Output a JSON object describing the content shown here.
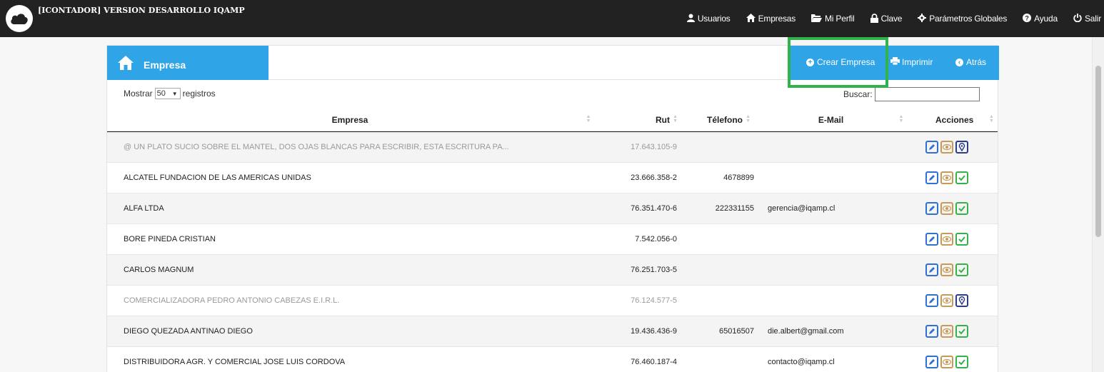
{
  "brand": "[ICONTADOR] VERSION DESARROLLO IQAMP",
  "nav": [
    {
      "label": "Usuarios",
      "icon": "user-icon"
    },
    {
      "label": "Empresas",
      "icon": "home-icon"
    },
    {
      "label": "Mi Perfil",
      "icon": "folder-icon"
    },
    {
      "label": "Clave",
      "icon": "lock-icon"
    },
    {
      "label": "Parámetros Globales",
      "icon": "gear-icon"
    },
    {
      "label": "Ayuda",
      "icon": "question-icon"
    },
    {
      "label": "Salir",
      "icon": "power-icon"
    }
  ],
  "panel": {
    "title": "Empresa",
    "actions": {
      "create": "Crear Empresa",
      "print": "Imprimir",
      "back": "Atrás"
    }
  },
  "controls": {
    "show_prefix": "Mostrar",
    "page_size": "50",
    "show_suffix": "registros",
    "search_label": "Buscar:",
    "search_value": ""
  },
  "table": {
    "columns": [
      "Empresa",
      "Rut",
      "Télefono",
      "E-Mail",
      "Acciones"
    ],
    "rows": [
      {
        "empresa": "@ UN PLATO SUCIO SOBRE EL MANTEL, DOS OJAS BLANCAS PARA ESCRIBIR, ESTA ESCRITURA PA...",
        "rut": "17.643.105-9",
        "telefono": "",
        "email": "",
        "muted": true,
        "third": "map-pin"
      },
      {
        "empresa": "ALCATEL FUNDACION DE LAS AMERICAS UNIDAS",
        "rut": "23.666.358-2",
        "telefono": "4678899",
        "email": "",
        "muted": false,
        "third": "check"
      },
      {
        "empresa": "ALFA LTDA",
        "rut": "76.351.470-6",
        "telefono": "222331155",
        "email": "gerencia@iqamp.cl",
        "muted": false,
        "third": "check"
      },
      {
        "empresa": "BORE PINEDA CRISTIAN",
        "rut": "7.542.056-0",
        "telefono": "",
        "email": "",
        "muted": false,
        "third": "check"
      },
      {
        "empresa": "CARLOS MAGNUM",
        "rut": "76.251.703-5",
        "telefono": "",
        "email": "",
        "muted": false,
        "third": "check"
      },
      {
        "empresa": "COMERCIALIZADORA PEDRO ANTONIO CABEZAS E.I.R.L.",
        "rut": "76.124.577-5",
        "telefono": "",
        "email": "",
        "muted": true,
        "third": "map-pin"
      },
      {
        "empresa": "DIEGO QUEZADA ANTINAO DIEGO",
        "rut": "19.436.436-9",
        "telefono": "65016507",
        "email": "die.albert@gmail.com",
        "muted": false,
        "third": "check"
      },
      {
        "empresa": "DISTRIBUIDORA AGR. Y COMERCIAL JOSE LUIS CORDOVA",
        "rut": "76.460.187-4",
        "telefono": "",
        "email": "contacto@iqamp.cl",
        "muted": false,
        "third": "check"
      }
    ]
  },
  "colors": {
    "navbar": "#222222",
    "accent": "#2fa4e7",
    "highlight": "#2fb34a"
  }
}
